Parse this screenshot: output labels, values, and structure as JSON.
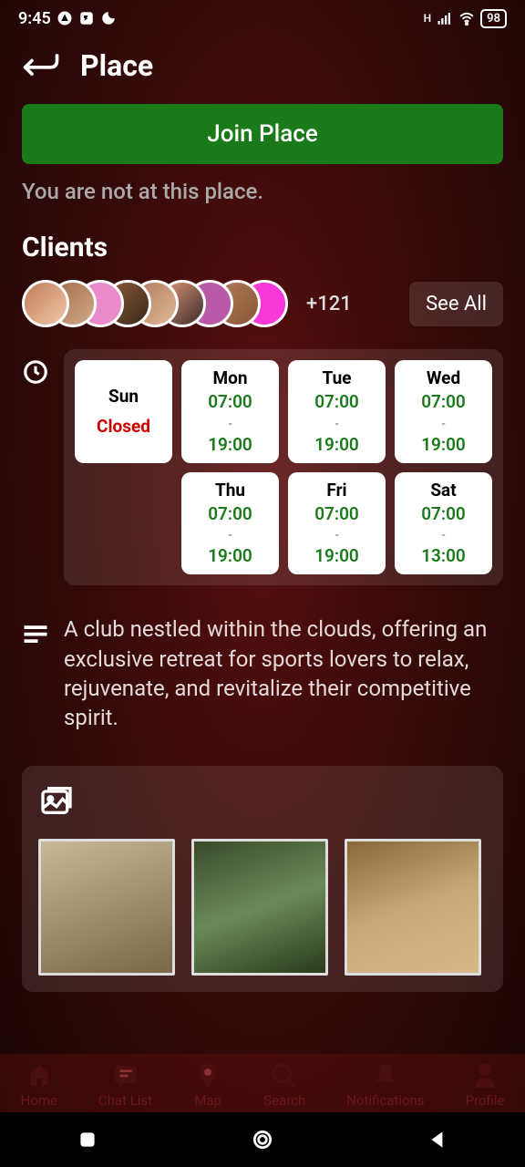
{
  "status_bar": {
    "time": "9:45",
    "network_indicator": "H",
    "battery": "98"
  },
  "header": {
    "title": "Place"
  },
  "join_button_label": "Join Place",
  "not_at_place_text": "You are not at this place.",
  "clients": {
    "section_title": "Clients",
    "more_count": "+121",
    "see_all_label": "See All"
  },
  "hours": {
    "days": [
      {
        "name": "Sun",
        "closed": true,
        "closed_label": "Closed"
      },
      {
        "name": "Mon",
        "open": "07:00",
        "close": "19:00"
      },
      {
        "name": "Tue",
        "open": "07:00",
        "close": "19:00"
      },
      {
        "name": "Wed",
        "open": "07:00",
        "close": "19:00"
      },
      {
        "name": "Thu",
        "open": "07:00",
        "close": "19:00"
      },
      {
        "name": "Fri",
        "open": "07:00",
        "close": "19:00"
      },
      {
        "name": "Sat",
        "open": "07:00",
        "close": "13:00"
      }
    ]
  },
  "description": "A club nestled within the clouds, offering an exclusive retreat for sports lovers to relax, rejuvenate, and revitalize their competitive spirit.",
  "bottom_nav": {
    "items": [
      {
        "label": "Home"
      },
      {
        "label": "Chat List"
      },
      {
        "label": "Map"
      },
      {
        "label": "Search"
      },
      {
        "label": "Notifications"
      },
      {
        "label": "Profile"
      }
    ]
  }
}
